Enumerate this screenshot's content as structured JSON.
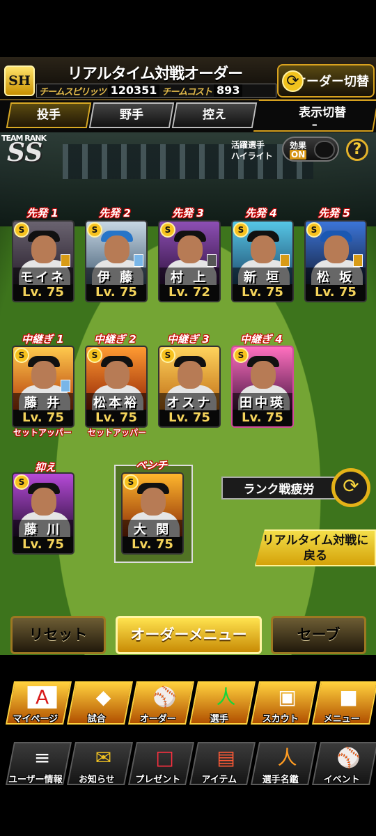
{
  "header": {
    "team_logo": "SH",
    "title": "リアルタイム対戦オーダー",
    "spirits_label": "チームスピリッツ",
    "spirits_value": "120351",
    "cost_label": "チームコスト",
    "cost_value": "893",
    "order_switch": "オーダー切替"
  },
  "tabs": [
    {
      "label": "投手",
      "active": true
    },
    {
      "label": "野手",
      "active": false
    },
    {
      "label": "控え",
      "active": false
    }
  ],
  "display_toggle": {
    "label": "表示切替",
    "value": "–"
  },
  "team_rank": {
    "label": "TEAM RANK",
    "value": "SS"
  },
  "highlight": {
    "label_line1": "活躍選手",
    "label_line2": "ハイライト",
    "effect_label": "効果",
    "effect_state": "ON"
  },
  "help": {
    "label": "?"
  },
  "starters": [
    {
      "slot": "先発 1",
      "rank": "S",
      "name": "モイネロ",
      "level": "Lv. 75"
    },
    {
      "slot": "先発 2",
      "rank": "S",
      "name": "伊 藤",
      "level": "Lv. 75"
    },
    {
      "slot": "先発 3",
      "rank": "S",
      "name": "村 上",
      "level": "Lv. 72"
    },
    {
      "slot": "先発 4",
      "rank": "S",
      "name": "新 垣",
      "level": "Lv. 75"
    },
    {
      "slot": "先発 5",
      "rank": "S",
      "name": "松 坂",
      "level": "Lv. 75"
    }
  ],
  "relievers": [
    {
      "slot": "中継ぎ 1",
      "rank": "S",
      "name": "藤 井",
      "level": "Lv. 75",
      "note": "セットアッパー"
    },
    {
      "slot": "中継ぎ 2",
      "rank": "S",
      "name": "松本裕",
      "level": "Lv. 75",
      "note": "セットアッパー"
    },
    {
      "slot": "中継ぎ 3",
      "rank": "S",
      "name": "オスナ",
      "level": "Lv. 75",
      "note": ""
    },
    {
      "slot": "中継ぎ 4",
      "rank": "S",
      "name": "田中瑛",
      "level": "Lv. 75",
      "note": ""
    }
  ],
  "closer": {
    "slot": "抑え",
    "rank": "S",
    "name": "藤 川",
    "level": "Lv. 75"
  },
  "bench": {
    "slot": "ベンチ",
    "rank": "S",
    "name": "大 関",
    "level": "Lv. 75"
  },
  "fatigue_button": "ランク戦疲労",
  "return_button": {
    "line1": "リアルタイム対戦に",
    "line2": "戻る"
  },
  "bottom_buttons": {
    "reset": "リセット",
    "order_menu": "オーダーメニュー",
    "save": "セーブ"
  },
  "nav_row1": [
    {
      "label": "マイページ",
      "icon": "A"
    },
    {
      "label": "試合",
      "icon": "◆"
    },
    {
      "label": "オーダー",
      "icon": "⚾"
    },
    {
      "label": "選手",
      "icon": "人"
    },
    {
      "label": "スカウト",
      "icon": "▣"
    },
    {
      "label": "メニュー",
      "icon": "■"
    }
  ],
  "nav_row2": [
    {
      "label": "ユーザー情報",
      "icon": "≡"
    },
    {
      "label": "お知らせ",
      "icon": "✉"
    },
    {
      "label": "プレゼント",
      "icon": "□"
    },
    {
      "label": "アイテム",
      "icon": "▤"
    },
    {
      "label": "選手名鑑",
      "icon": "人"
    },
    {
      "label": "イベント",
      "icon": "⚾"
    }
  ],
  "colors": {
    "gold": "#d9aa25",
    "accent": "#f4d35b",
    "slot_red": "#cc0000"
  }
}
